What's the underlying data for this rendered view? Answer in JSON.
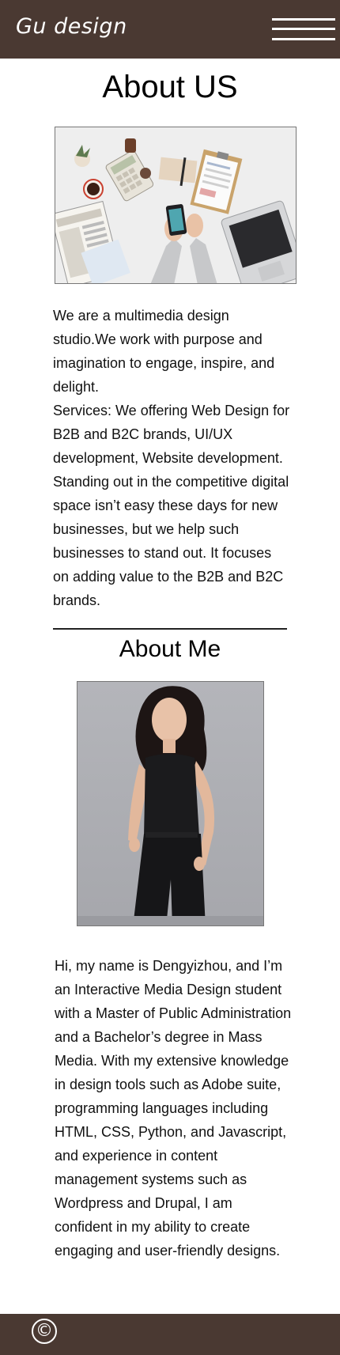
{
  "header": {
    "logo": "Gu design",
    "menu_icon": "hamburger-menu-icon",
    "bg_color": "#4a3932"
  },
  "about_us": {
    "title": "About US",
    "image_alt": "office-desk-photo",
    "paragraph1": "We are a multimedia design studio.We work with purpose and imagination to engage, inspire, and delight.",
    "paragraph2": "Services: We offering Web Design for B2B and B2C brands, UI/UX development, Website development. Standing out in the competitive digital space isn’t easy these days for new businesses, but we help such businesses to stand out. It focuses on adding value to the B2B and B2C brands."
  },
  "about_me": {
    "title": "About Me",
    "image_alt": "portrait-photo",
    "paragraph": "Hi, my name is Dengyizhou, and I’m an Interactive Media Design student with a Master of Public Administration and a Bachelor’s degree in Mass Media. With my extensive knowledge in design tools such as Adobe suite, programming languages including HTML, CSS, Python, and Javascript, and experience in content management systems such as Wordpress and Drupal, I am confident in my ability to create engaging and user-friendly designs."
  },
  "footer": {
    "copyright_symbol": "©",
    "bg_color": "#4a3932"
  }
}
